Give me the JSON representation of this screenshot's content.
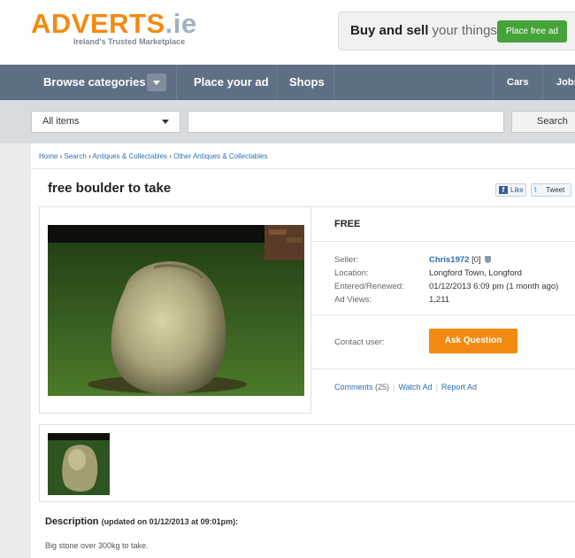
{
  "header": {
    "logo_brand": "ADVERTS",
    "logo_tld": ".ie",
    "logo_tagline": "Ireland's Trusted Marketplace",
    "promo_bold": "Buy and sell",
    "promo_light": "your things",
    "promo_button": "Place free ad"
  },
  "nav": {
    "browse": "Browse categories",
    "place_ad": "Place your ad",
    "shops": "Shops",
    "cars": "Cars",
    "jobs": "Jobs"
  },
  "search": {
    "category_selected": "All items",
    "query": "",
    "button": "Search"
  },
  "breadcrumb": [
    "Home",
    "Search",
    "Antiques & Collectables",
    "Other Antiques & Collectables"
  ],
  "breadcrumb_sep": "›",
  "ad": {
    "title": "free boulder to take",
    "price": "FREE",
    "seller_label": "Seller:",
    "seller_name": "Chris1972",
    "seller_rating": "[0]",
    "location_label": "Location:",
    "location_value": "Longford Town, Longford",
    "entered_label": "Entered/Renewed:",
    "entered_value": "01/12/2013 6:09 pm (1 month ago)",
    "views_label": "Ad Views:",
    "views_value": "1,211",
    "contact_label": "Contact user:",
    "ask_button": "Ask Question",
    "comments_label": "Comments",
    "comments_count": "(25)",
    "watch": "Watch Ad",
    "report": "Report Ad",
    "description_heading": "Description",
    "description_updated": "(updated on 01/12/2013 at 09:01pm):",
    "description_text": "Big stone over 300kg to take."
  },
  "social": {
    "fb_icon": "f",
    "like": "Like",
    "tw_icon": "t",
    "tweet": "Tweet"
  },
  "colors": {
    "brand_orange": "#f28a12",
    "nav_bg": "#5f7084",
    "link_blue": "#2a6ebb",
    "promo_green": "#46a33a"
  },
  "icons": [
    "dropdown-caret-icon",
    "verified-shield-icon",
    "facebook-icon",
    "twitter-icon"
  ]
}
